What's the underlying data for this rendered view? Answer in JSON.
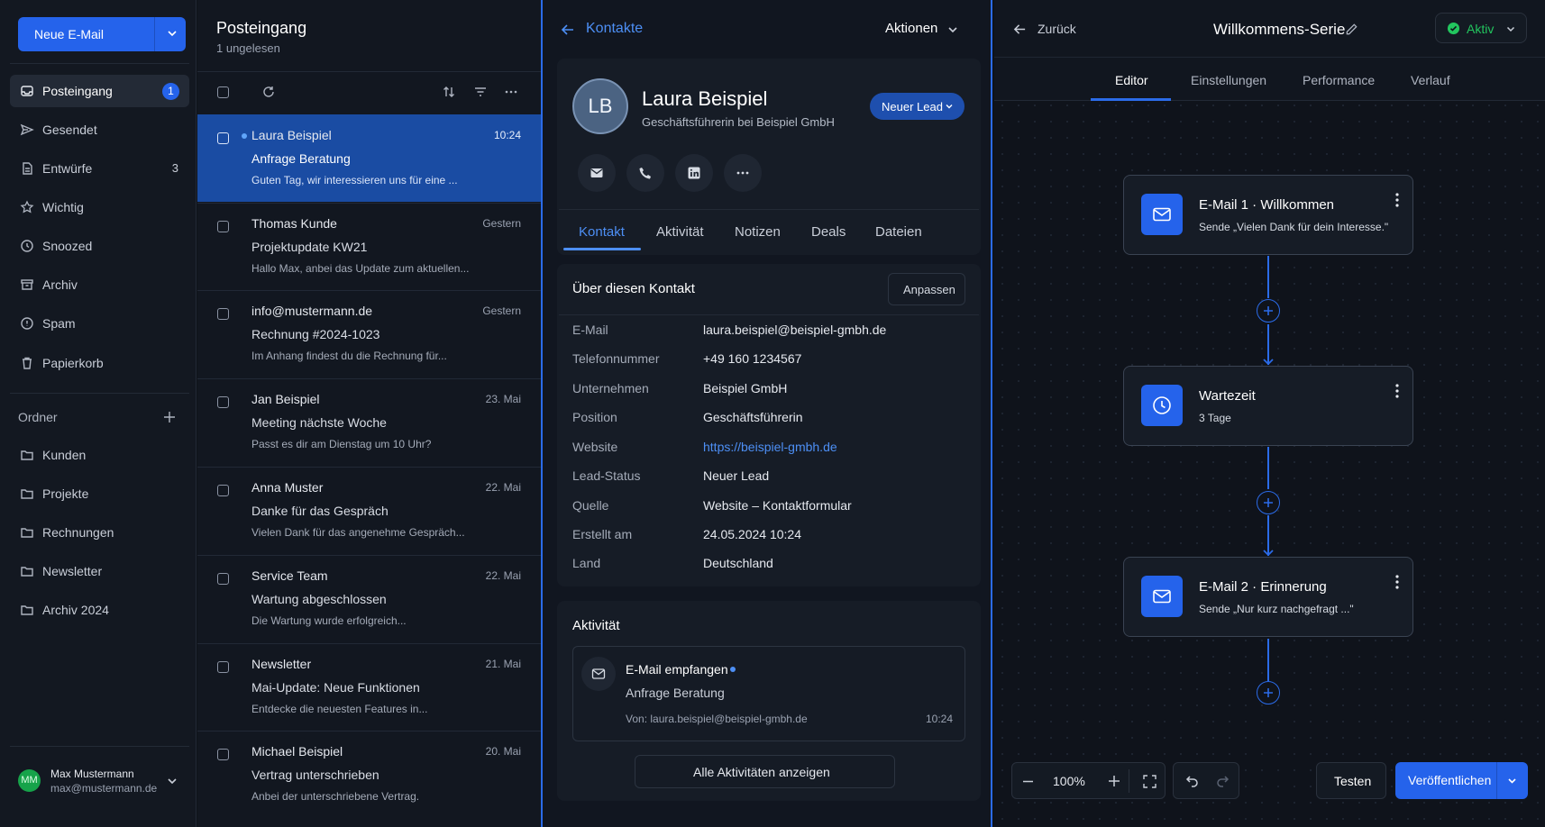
{
  "sidebar": {
    "new_mail": "Neue E-Mail",
    "items": [
      {
        "label": "Posteingang",
        "badge": "1"
      },
      {
        "label": "Gesendet"
      },
      {
        "label": "Entwürfe",
        "count": "3"
      },
      {
        "label": "Wichtig"
      },
      {
        "label": "Snoozed"
      },
      {
        "label": "Archiv"
      },
      {
        "label": "Spam"
      },
      {
        "label": "Papierkorb"
      }
    ],
    "folders_label": "Ordner",
    "folders": [
      "Kunden",
      "Projekte",
      "Rechnungen",
      "Newsletter",
      "Archiv 2024"
    ],
    "user": {
      "initials": "MM",
      "name": "Max Mustermann",
      "email": "max@mustermann.de"
    }
  },
  "inbox": {
    "title": "Posteingang",
    "subtitle": "1 ungelesen",
    "mails": [
      {
        "sender": "Laura Beispiel",
        "time": "10:24",
        "subject": "Anfrage Beratung",
        "preview": "Guten Tag, wir interessieren uns für eine ...",
        "selected": true,
        "unread": true
      },
      {
        "sender": "Thomas Kunde",
        "time": "Gestern",
        "subject": "Projektupdate KW21",
        "preview": "Hallo Max, anbei das Update zum aktuellen..."
      },
      {
        "sender": "info@mustermann.de",
        "time": "Gestern",
        "subject": "Rechnung #2024-1023",
        "preview": "Im Anhang findest du die Rechnung für..."
      },
      {
        "sender": "Jan Beispiel",
        "time": "23. Mai",
        "subject": "Meeting nächste Woche",
        "preview": "Passt es dir am Dienstag um 10 Uhr?"
      },
      {
        "sender": "Anna Muster",
        "time": "22. Mai",
        "subject": "Danke für das Gespräch",
        "preview": "Vielen Dank für das angenehme Gespräch..."
      },
      {
        "sender": "Service Team",
        "time": "22. Mai",
        "subject": "Wartung abgeschlossen",
        "preview": "Die Wartung wurde erfolgreich..."
      },
      {
        "sender": "Newsletter",
        "time": "21. Mai",
        "subject": "Mai-Update: Neue Funktionen",
        "preview": "Entdecke die neuesten Features in..."
      },
      {
        "sender": "Michael Beispiel",
        "time": "20. Mai",
        "subject": "Vertrag unterschrieben",
        "preview": "Anbei der unterschriebene Vertrag."
      }
    ]
  },
  "contact": {
    "back": "Kontakte",
    "actions": "Aktionen",
    "initials": "LB",
    "name": "Laura Beispiel",
    "role": "Geschäftsführerin bei Beispiel GmbH",
    "lead": "Neuer Lead",
    "tabs": [
      "Kontakt",
      "Aktivität",
      "Notizen",
      "Deals",
      "Dateien"
    ],
    "about_title": "Über diesen Kontakt",
    "customize": "Anpassen",
    "fields": [
      {
        "label": "E-Mail",
        "value": "laura.beispiel@beispiel-gmbh.de"
      },
      {
        "label": "Telefonnummer",
        "value": "+49 160 1234567"
      },
      {
        "label": "Unternehmen",
        "value": "Beispiel GmbH"
      },
      {
        "label": "Position",
        "value": "Geschäftsführerin"
      },
      {
        "label": "Website",
        "value": "https://beispiel-gmbh.de",
        "link": true
      },
      {
        "label": "Lead-Status",
        "value": "Neuer Lead"
      },
      {
        "label": "Quelle",
        "value": "Website – Kontaktformular"
      },
      {
        "label": "Erstellt am",
        "value": "24.05.2024 10:24"
      },
      {
        "label": "Land",
        "value": "Deutschland"
      }
    ],
    "activity": {
      "title": "Aktivität",
      "item_title": "E-Mail empfangen",
      "item_subject": "Anfrage Beratung",
      "item_from": "Von: laura.beispiel@beispiel-gmbh.de",
      "item_time": "10:24",
      "show_all": "Alle Aktivitäten anzeigen"
    }
  },
  "editor": {
    "back": "Zurück",
    "title": "Willkommens-Serie",
    "status": "Aktiv",
    "tabs": [
      "Editor",
      "Einstellungen",
      "Performance",
      "Verlauf"
    ],
    "nodes": [
      {
        "title": "E-Mail 1 · Willkommen",
        "desc": "Sende „Vielen Dank für dein Interesse.\"",
        "icon": "mail-icon"
      },
      {
        "title": "Wartezeit",
        "desc": "3 Tage",
        "icon": "clock-icon"
      },
      {
        "title": "E-Mail 2 · Erinnerung",
        "desc": "Sende „Nur kurz nachgefragt ...\"",
        "icon": "mail-icon"
      }
    ],
    "zoom": "100%",
    "test": "Testen",
    "publish": "Veröffentlichen"
  },
  "colors": {
    "accent": "#2563eb",
    "link": "#4d8ff5",
    "active": "#22c55e"
  }
}
